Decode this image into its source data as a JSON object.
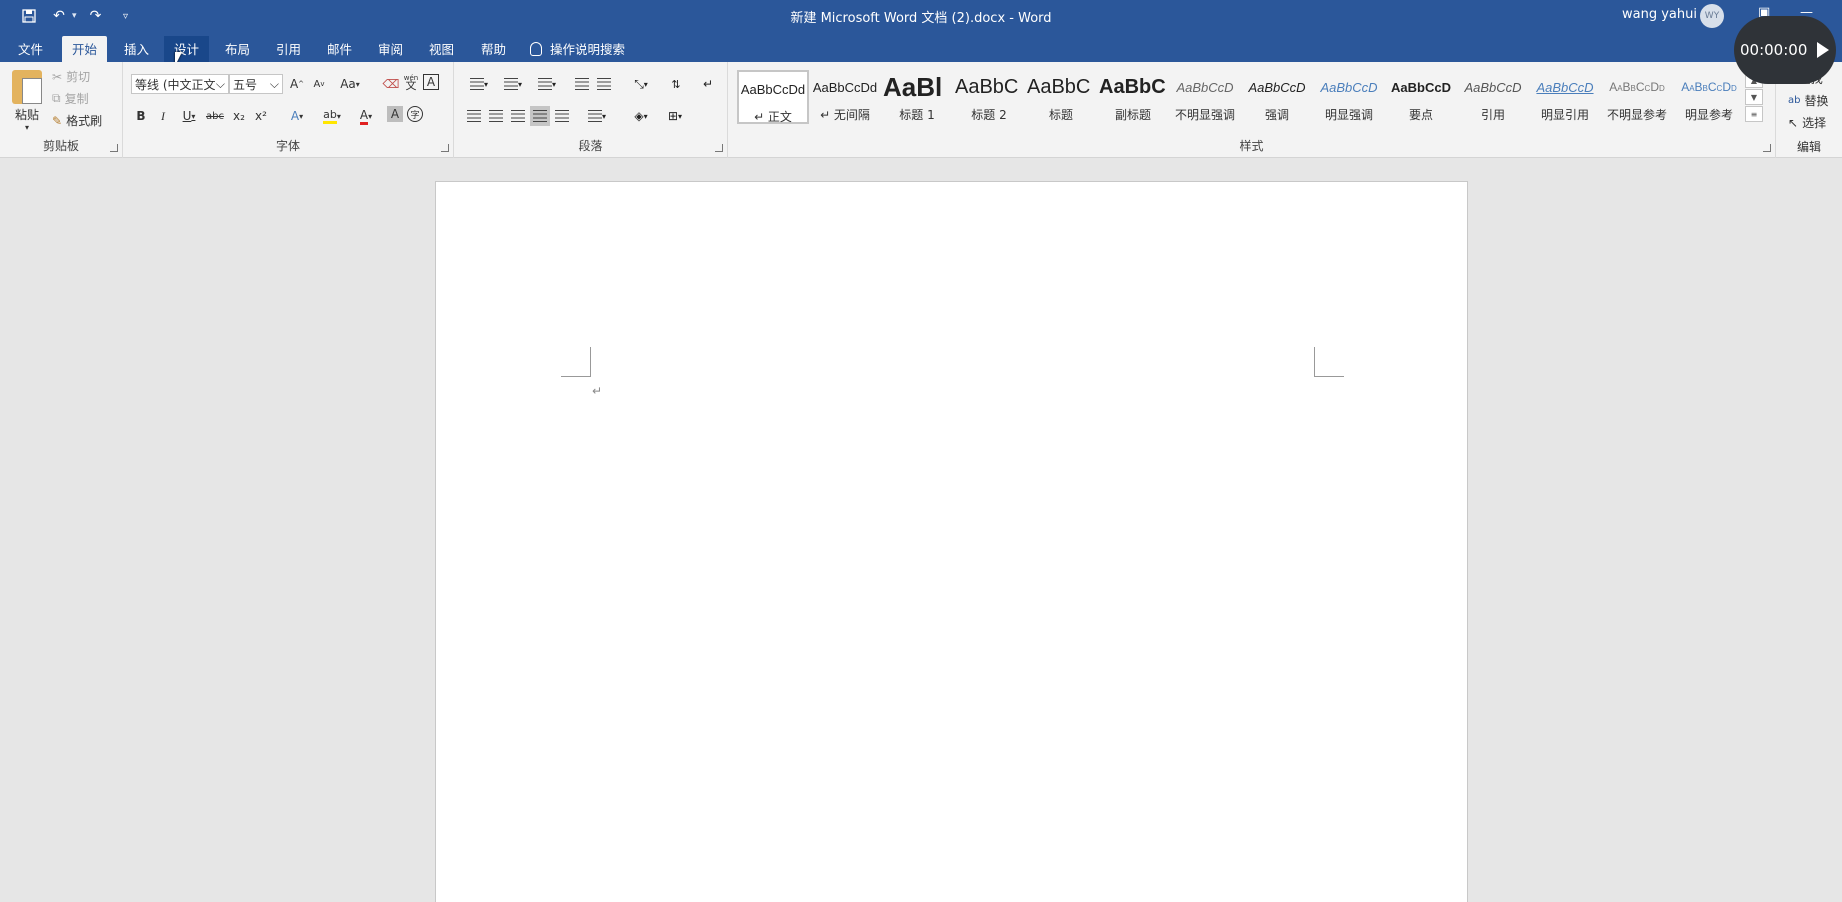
{
  "window": {
    "title": "新建 Microsoft Word 文档 (2).docx  -  Word",
    "user_name": "wang yahui",
    "user_initials": "WY",
    "timer": "00:00:00"
  },
  "tabs": [
    "文件",
    "开始",
    "插入",
    "设计",
    "布局",
    "引用",
    "邮件",
    "审阅",
    "视图",
    "帮助"
  ],
  "tell_me": "操作说明搜索",
  "clipboard": {
    "paste": "粘贴",
    "cut": "剪切",
    "copy": "复制",
    "format_painter": "格式刷",
    "group_label": "剪贴板"
  },
  "font": {
    "font_name": "等线 (中文正文",
    "font_size": "五号",
    "grow": "A",
    "shrink": "A",
    "change_case": "Aa",
    "bold": "B",
    "italic": "I",
    "underline": "U",
    "strikethrough": "abc",
    "subscript": "x₂",
    "superscript": "x²",
    "text_effect": "A",
    "highlight": "ab",
    "font_color": "A",
    "char_shading": "A",
    "enclose": "字",
    "pinyin": "wén",
    "pinyin_char": "文",
    "char_border": "A",
    "group_label": "字体"
  },
  "paragraph": {
    "group_label": "段落"
  },
  "styles": {
    "group_label": "样式",
    "items": [
      {
        "sample": "AaBbCcDd",
        "name": "↵ 正文"
      },
      {
        "sample": "AaBbCcDd",
        "name": "↵ 无间隔"
      },
      {
        "sample": "AaBl",
        "name": "标题 1"
      },
      {
        "sample": "AaBbC",
        "name": "标题 2"
      },
      {
        "sample": "AaBbC",
        "name": "标题"
      },
      {
        "sample": "AaBbC",
        "name": "副标题"
      },
      {
        "sample": "AaBbCcD",
        "name": "不明显强调"
      },
      {
        "sample": "AaBbCcD",
        "name": "强调"
      },
      {
        "sample": "AaBbCcD",
        "name": "明显强调"
      },
      {
        "sample": "AaBbCcD",
        "name": "要点"
      },
      {
        "sample": "AaBbCcD",
        "name": "引用"
      },
      {
        "sample": "AaBbCcD",
        "name": "明显引用"
      },
      {
        "sample": "AaBbCcDd",
        "name": "不明显参考"
      },
      {
        "sample": "AaBbCcDd",
        "name": "明显参考"
      }
    ]
  },
  "editing": {
    "find": "查找",
    "replace": "替换",
    "select": "选择",
    "group_label": "编辑"
  },
  "document": {
    "paragraph_mark": "↵"
  }
}
